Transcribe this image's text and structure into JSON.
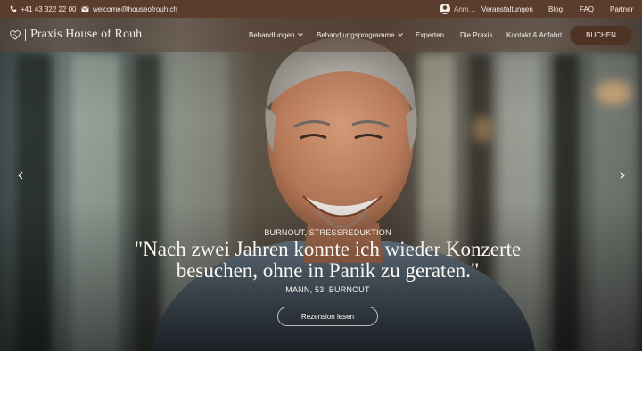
{
  "topbar": {
    "phone": "+41 43 322 22 00",
    "email": "welcome@houseofrouh.ch",
    "account_label": "Anm…",
    "links": [
      "Veranstaltungen",
      "Blog",
      "FAQ",
      "Partner"
    ]
  },
  "nav": {
    "logo_text": "Praxis House of Rouh",
    "items": [
      "Behandlungen",
      "Behandlungsprogramme",
      "Experten",
      "Die Praxis",
      "Kontakt & Anfahrt"
    ],
    "book_label": "BUCHEN"
  },
  "hero": {
    "category": "BURNOUT, STRESSREDUKTION",
    "quote": "\"Nach zwei Jahren konnte ich wieder Konzerte besuchen, ohne in Panik zu geraten.\"",
    "author": "MANN, 53, BURNOUT",
    "button_label": "Rezension lesen"
  },
  "colors": {
    "topbar_bg": "#5b3d2e",
    "book_button_bg": "#4e3325",
    "text_light": "#f5efe9"
  }
}
